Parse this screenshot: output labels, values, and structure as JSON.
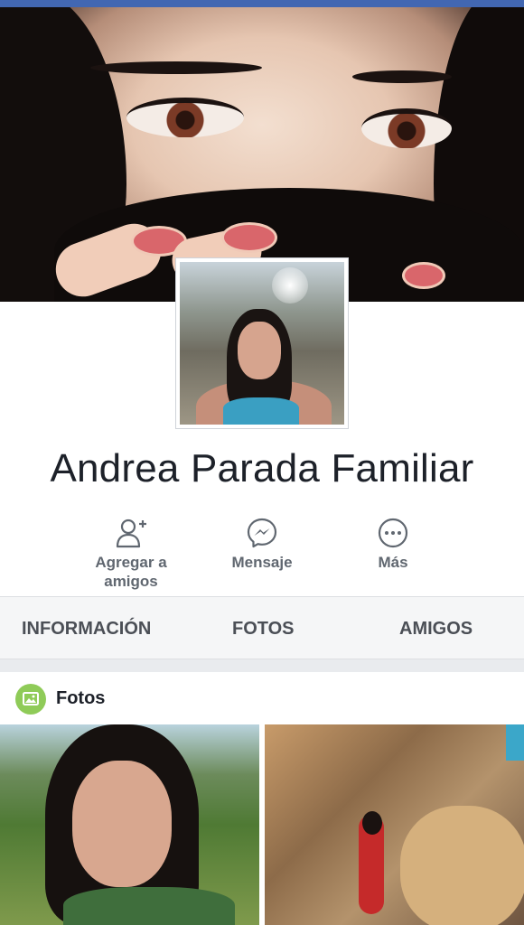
{
  "profile": {
    "name": "Andrea Parada Familiar"
  },
  "actions": [
    {
      "label": "Agregar a amigos",
      "icon": "add-friend-icon"
    },
    {
      "label": "Mensaje",
      "icon": "messenger-icon"
    },
    {
      "label": "Más",
      "icon": "more-icon"
    }
  ],
  "tabs": [
    {
      "label": "INFORMACIÓN"
    },
    {
      "label": "FOTOS"
    },
    {
      "label": "AMIGOS"
    }
  ],
  "photos": {
    "title": "Fotos",
    "icon": "photos-icon"
  },
  "colors": {
    "brand": "#4267b2",
    "photos_icon": "#8fcb58",
    "text_secondary": "#606770"
  }
}
